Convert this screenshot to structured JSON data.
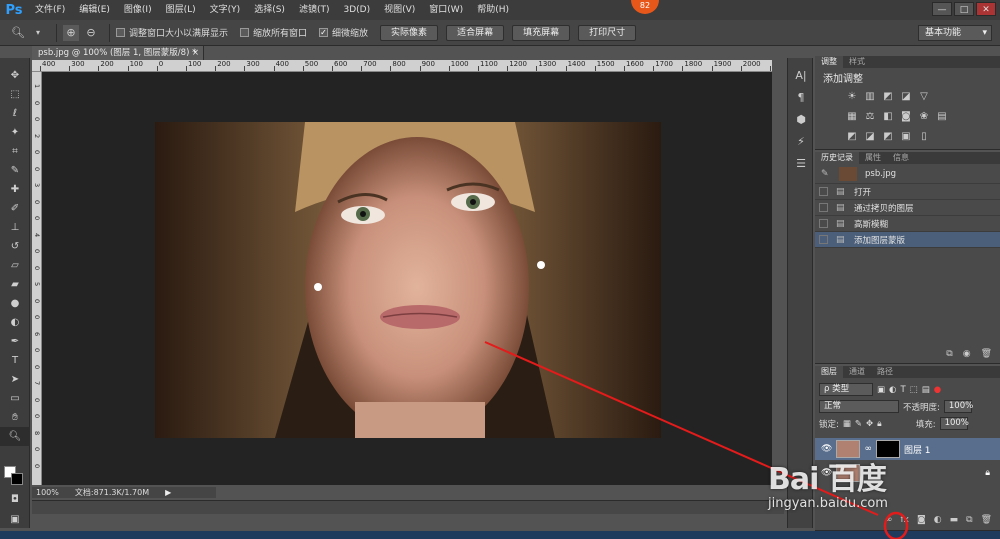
{
  "app": {
    "logo": "Ps",
    "menu": [
      "文件(F)",
      "编辑(E)",
      "图像(I)",
      "图层(L)",
      "文字(Y)",
      "选择(S)",
      "滤镜(T)",
      "3D(D)",
      "视图(V)",
      "窗口(W)",
      "帮助(H)"
    ],
    "notification_badge": "82",
    "window_buttons": [
      "—",
      "□",
      "✕"
    ]
  },
  "options_bar": {
    "checkbox_fit_window": "调整窗口大小以满屏显示",
    "checkbox_zoom_all": "缩放所有窗口",
    "checkbox_scrubby": "细微缩放",
    "scrubby_checked": true,
    "buttons": [
      "实际像素",
      "适合屏幕",
      "填充屏幕",
      "打印尺寸"
    ],
    "workspace": "基本功能"
  },
  "document": {
    "tab_title": "psb.jpg @ 100% (图层 1, 图层蒙版/8) *",
    "ruler_h": [
      "400",
      "300",
      "200",
      "100",
      "0",
      "100",
      "200",
      "300",
      "400",
      "500",
      "600",
      "700",
      "800",
      "900",
      "1000",
      "1100",
      "1200",
      "1300",
      "1400",
      "1500",
      "1600",
      "1700",
      "1800",
      "1900",
      "2000",
      "210"
    ],
    "ruler_v": [
      "1",
      "0",
      "0",
      "2",
      "0",
      "0",
      "3",
      "0",
      "0",
      "4",
      "0",
      "0",
      "5",
      "0",
      "0",
      "6",
      "0",
      "0",
      "7",
      "0",
      "0",
      "8",
      "0",
      "0"
    ],
    "zoom": "100%",
    "doc_info": "文档:871.3K/1.70M"
  },
  "adjustments_panel": {
    "tabs": [
      "调整",
      "样式"
    ],
    "title": "添加调整"
  },
  "history_panel": {
    "tabs": [
      "历史记录",
      "属性",
      "信息"
    ],
    "snapshot": "psb.jpg",
    "items": [
      "打开",
      "通过拷贝的图层",
      "高斯模糊",
      "添加图层蒙版"
    ],
    "active_index": 3
  },
  "layers_panel": {
    "tabs": [
      "图层",
      "通道",
      "路径"
    ],
    "filter": "ρ 类型",
    "blend_mode": "正常",
    "opacity_label": "不透明度:",
    "opacity_value": "100%",
    "lock_label": "锁定:",
    "fill_label": "填充:",
    "fill_value": "100%",
    "layers": [
      "图层 1"
    ]
  },
  "watermark": {
    "logo": "Bai 百度",
    "url": "jingyan.baidu.com"
  },
  "colors": {
    "annotation_red": "#e31b1b",
    "selection_blue": "#4b5f7a"
  }
}
